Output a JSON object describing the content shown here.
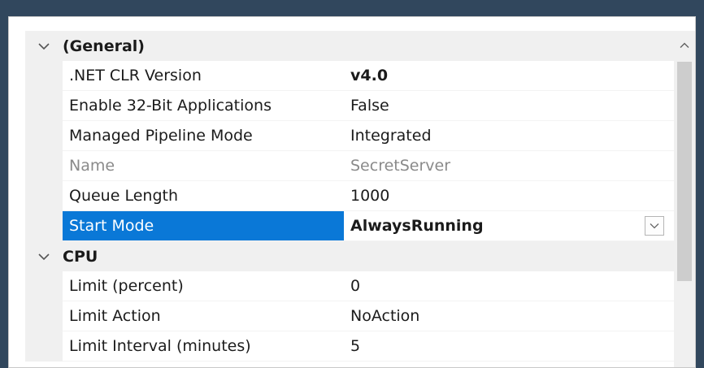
{
  "categories": [
    {
      "label": "(General)",
      "properties": [
        {
          "name": ".NET CLR Version",
          "value": "v4.0",
          "bold": true
        },
        {
          "name": "Enable 32-Bit Applications",
          "value": "False"
        },
        {
          "name": "Managed Pipeline Mode",
          "value": "Integrated"
        },
        {
          "name": "Name",
          "value": "SecretServer",
          "disabled": true
        },
        {
          "name": "Queue Length",
          "value": "1000"
        },
        {
          "name": "Start Mode",
          "value": "AlwaysRunning",
          "selected": true
        }
      ]
    },
    {
      "label": "CPU",
      "properties": [
        {
          "name": "Limit (percent)",
          "value": "0"
        },
        {
          "name": "Limit Action",
          "value": "NoAction"
        },
        {
          "name": "Limit Interval (minutes)",
          "value": "5"
        }
      ]
    }
  ],
  "icons": {
    "expander": "chevron-down-icon",
    "dropdown": "chevron-down-icon",
    "scroll_up": "chevron-up-icon"
  },
  "colors": {
    "selection": "#0a78d7",
    "category_background": "#f0f0f0"
  }
}
